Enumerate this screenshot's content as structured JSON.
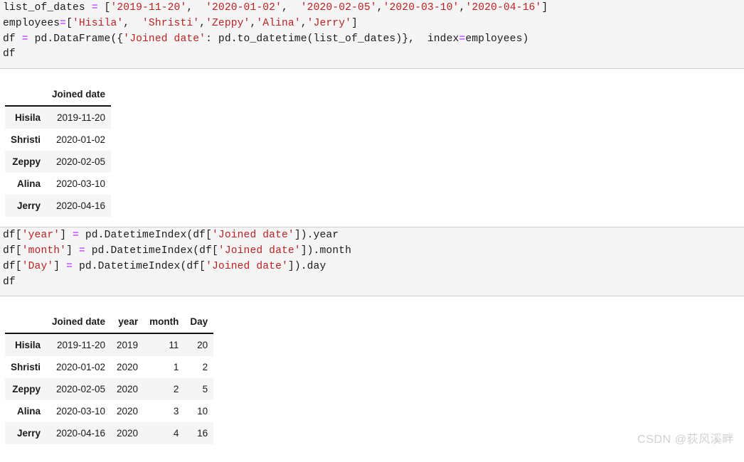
{
  "cells": [
    {
      "id": "cell-1",
      "type": "code",
      "lines": [
        [
          {
            "t": "plain",
            "s": "list_of_dates "
          },
          {
            "t": "op",
            "s": "="
          },
          {
            "t": "plain",
            "s": " ["
          },
          {
            "t": "str",
            "s": "'2019-11-20'"
          },
          {
            "t": "plain",
            "s": ",  "
          },
          {
            "t": "str",
            "s": "'2020-01-02'"
          },
          {
            "t": "plain",
            "s": ",  "
          },
          {
            "t": "str",
            "s": "'2020-02-05'"
          },
          {
            "t": "plain",
            "s": ","
          },
          {
            "t": "str",
            "s": "'2020-03-10'"
          },
          {
            "t": "plain",
            "s": ","
          },
          {
            "t": "str",
            "s": "'2020-04-16'"
          },
          {
            "t": "plain",
            "s": "]"
          }
        ],
        [
          {
            "t": "plain",
            "s": "employees"
          },
          {
            "t": "op",
            "s": "="
          },
          {
            "t": "plain",
            "s": "["
          },
          {
            "t": "str",
            "s": "'Hisila'"
          },
          {
            "t": "plain",
            "s": ",  "
          },
          {
            "t": "str",
            "s": "'Shristi'"
          },
          {
            "t": "plain",
            "s": ","
          },
          {
            "t": "str",
            "s": "'Zeppy'"
          },
          {
            "t": "plain",
            "s": ","
          },
          {
            "t": "str",
            "s": "'Alina'"
          },
          {
            "t": "plain",
            "s": ","
          },
          {
            "t": "str",
            "s": "'Jerry'"
          },
          {
            "t": "plain",
            "s": "]"
          }
        ],
        [
          {
            "t": "plain",
            "s": "df "
          },
          {
            "t": "op",
            "s": "="
          },
          {
            "t": "plain",
            "s": " pd.DataFrame({"
          },
          {
            "t": "str",
            "s": "'Joined date'"
          },
          {
            "t": "plain",
            "s": ": pd.to_datetime(list_of_dates)},  index"
          },
          {
            "t": "op",
            "s": "="
          },
          {
            "t": "plain",
            "s": "employees)"
          }
        ],
        [
          {
            "t": "plain",
            "s": "df"
          }
        ]
      ]
    },
    {
      "id": "cell-2",
      "type": "code",
      "lines": [
        [
          {
            "t": "plain",
            "s": "df["
          },
          {
            "t": "str",
            "s": "'year'"
          },
          {
            "t": "plain",
            "s": "] "
          },
          {
            "t": "op",
            "s": "="
          },
          {
            "t": "plain",
            "s": " pd.DatetimeIndex(df["
          },
          {
            "t": "str",
            "s": "'Joined date'"
          },
          {
            "t": "plain",
            "s": "]).year"
          }
        ],
        [
          {
            "t": "plain",
            "s": "df["
          },
          {
            "t": "str",
            "s": "'month'"
          },
          {
            "t": "plain",
            "s": "] "
          },
          {
            "t": "op",
            "s": "="
          },
          {
            "t": "plain",
            "s": " pd.DatetimeIndex(df["
          },
          {
            "t": "str",
            "s": "'Joined date'"
          },
          {
            "t": "plain",
            "s": "]).month"
          }
        ],
        [
          {
            "t": "plain",
            "s": "df["
          },
          {
            "t": "str",
            "s": "'Day'"
          },
          {
            "t": "plain",
            "s": "] "
          },
          {
            "t": "op",
            "s": "="
          },
          {
            "t": "plain",
            "s": " pd.DatetimeIndex(df["
          },
          {
            "t": "str",
            "s": "'Joined date'"
          },
          {
            "t": "plain",
            "s": "]).day"
          }
        ],
        [
          {
            "t": "plain",
            "s": "df"
          }
        ]
      ]
    }
  ],
  "table_1": {
    "index_header": "",
    "columns": [
      "Joined date"
    ],
    "index": [
      "Hisila",
      "Shristi",
      "Zeppy",
      "Alina",
      "Jerry"
    ],
    "rows": [
      [
        "2019-11-20"
      ],
      [
        "2020-01-02"
      ],
      [
        "2020-02-05"
      ],
      [
        "2020-03-10"
      ],
      [
        "2020-04-16"
      ]
    ]
  },
  "table_2": {
    "index_header": "",
    "columns": [
      "Joined date",
      "year",
      "month",
      "Day"
    ],
    "index": [
      "Hisila",
      "Shristi",
      "Zeppy",
      "Alina",
      "Jerry"
    ],
    "rows": [
      [
        "2019-11-20",
        "2019",
        "11",
        "20"
      ],
      [
        "2020-01-02",
        "2020",
        "1",
        "2"
      ],
      [
        "2020-02-05",
        "2020",
        "2",
        "5"
      ],
      [
        "2020-03-10",
        "2020",
        "3",
        "10"
      ],
      [
        "2020-04-16",
        "2020",
        "4",
        "16"
      ]
    ]
  },
  "watermark": {
    "text": "CSDN @荻风溪畔"
  },
  "colors": {
    "cell_background": "#f5f5f5",
    "string_token": "#ba2121",
    "operator_token": "#aa22ff",
    "text": "#1a1a1a",
    "row_stripe": "#f5f5f5",
    "header_rule": "#111111",
    "watermark": "#d0d0d0"
  }
}
